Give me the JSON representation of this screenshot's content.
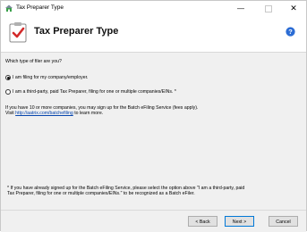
{
  "window": {
    "title": "Tax Preparer Type",
    "minimize_glyph": "—",
    "close_glyph": "✕"
  },
  "header": {
    "title": "Tax Preparer Type",
    "icon": "clipboard-check-icon",
    "help_icon": "help-icon"
  },
  "content": {
    "question": "Which type of filer are you?",
    "options": [
      {
        "label": "I am filing for my company/employer.",
        "selected": true
      },
      {
        "label": "I am a third-party, paid Tax Preparer, filing for one or multiple companies/EINs. *",
        "selected": false
      }
    ],
    "batch_note_line1": "If you have 10 or more companies, you may sign up for the Batch eFiling Service (fees apply).",
    "batch_note_visit": "Visit ",
    "batch_link": "http://aatrix.com/batchefiling",
    "batch_note_after": " to learn more.",
    "footnote_line1": "* If you have already signed up for the Batch eFiling Service, please select the option above \"I am a third-party, paid",
    "footnote_line2": "Tax Preparer, filing for one or multiple companies/EINs.\" to be recognized as a Batch eFiler."
  },
  "buttons": {
    "back": "< Back",
    "next": "Next >",
    "cancel": "Cancel"
  },
  "colors": {
    "link": "#0645ad",
    "default_button_border": "#0078d7",
    "help_icon": "#2b6cd4"
  }
}
